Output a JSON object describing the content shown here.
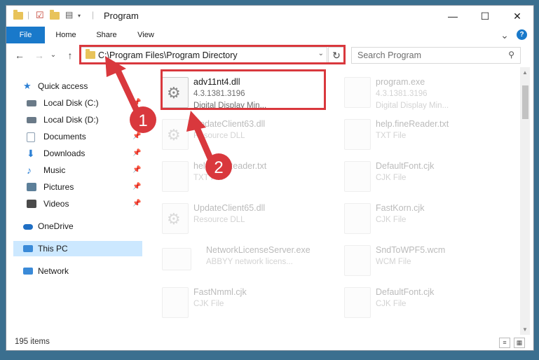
{
  "titlebar": {
    "title": "Program",
    "minimize": "—",
    "maximize": "☐",
    "close": "✕"
  },
  "ribbon": {
    "tabs": [
      "File",
      "Home",
      "Share",
      "View"
    ],
    "help": "?",
    "collapse": "⌄"
  },
  "nav": {
    "back": "←",
    "forward": "→",
    "recent": "⌄",
    "up": "↑",
    "address_path": "C:\\Program Files\\Program Directory",
    "refresh": "↻",
    "search_placeholder": "Search Program",
    "search_icon": "search-icon"
  },
  "sidebar": {
    "items": [
      {
        "label": "Quick access",
        "icon": "star-icon",
        "color": "#2b7fd4",
        "pinned": false
      },
      {
        "label": "Local Disk (C:)",
        "icon": "drive-icon",
        "color": "#6a7a88",
        "pinned": true
      },
      {
        "label": "Local Disk (D:)",
        "icon": "drive-icon",
        "color": "#6a7a88",
        "pinned": true
      },
      {
        "label": "Documents",
        "icon": "documents-icon",
        "color": "#8da0b3",
        "pinned": true
      },
      {
        "label": "Downloads",
        "icon": "downloads-icon",
        "color": "#2b7fd4",
        "pinned": true
      },
      {
        "label": "Music",
        "icon": "music-icon",
        "color": "#2b7fd4",
        "pinned": true
      },
      {
        "label": "Pictures",
        "icon": "pictures-icon",
        "color": "#5c7f99",
        "pinned": true
      },
      {
        "label": "Videos",
        "icon": "videos-icon",
        "color": "#4a4a4a",
        "pinned": true
      },
      {
        "label": "OneDrive",
        "icon": "onedrive-icon",
        "color": "#1f6fc4",
        "pinned": false
      },
      {
        "label": "This PC",
        "icon": "computer-icon",
        "color": "#3a8ad8",
        "pinned": false
      },
      {
        "label": "Network",
        "icon": "network-icon",
        "color": "#3a8ad8",
        "pinned": false
      }
    ],
    "pin_glyph": "📌"
  },
  "files": [
    {
      "name": "adv11nt4.dll",
      "line2": "4.3.1381.3196",
      "line3": "Digital Display Min...",
      "highlighted": true
    },
    {
      "name": "program.exe",
      "line2": "4.3.1381.3196",
      "line3": "Digital Display Min...",
      "highlighted": false
    },
    {
      "name": "UpdateClient63.dll",
      "line2": "Resource DLL",
      "line3": "",
      "highlighted": false
    },
    {
      "name": "help.fineReader.txt",
      "line2": "TXT File",
      "line3": "",
      "highlighted": false
    },
    {
      "name": "help.fineReader.txt",
      "line2": "TXT File",
      "line3": "",
      "highlighted": false
    },
    {
      "name": "DefaultFont.cjk",
      "line2": "CJK File",
      "line3": "",
      "highlighted": false
    },
    {
      "name": "UpdateClient65.dll",
      "line2": "Resource DLL",
      "line3": "",
      "highlighted": false
    },
    {
      "name": "FastKorn.cjk",
      "line2": "CJK File",
      "line3": "",
      "highlighted": false
    },
    {
      "name": "NetworkLicenseServer.exe",
      "line2": "ABBYY network licens...",
      "line3": "",
      "highlighted": false
    },
    {
      "name": "SndToWPF5.wcm",
      "line2": "WCM File",
      "line3": "",
      "highlighted": false
    },
    {
      "name": "FastNmml.cjk",
      "line2": "CJK File",
      "line3": "",
      "highlighted": false
    },
    {
      "name": "DefaultFont.cjk",
      "line2": "CJK File",
      "line3": "",
      "highlighted": false
    }
  ],
  "status": {
    "count": "195 items"
  },
  "annotations": {
    "step1": "1",
    "step2": "2",
    "color": "#d9383d"
  }
}
